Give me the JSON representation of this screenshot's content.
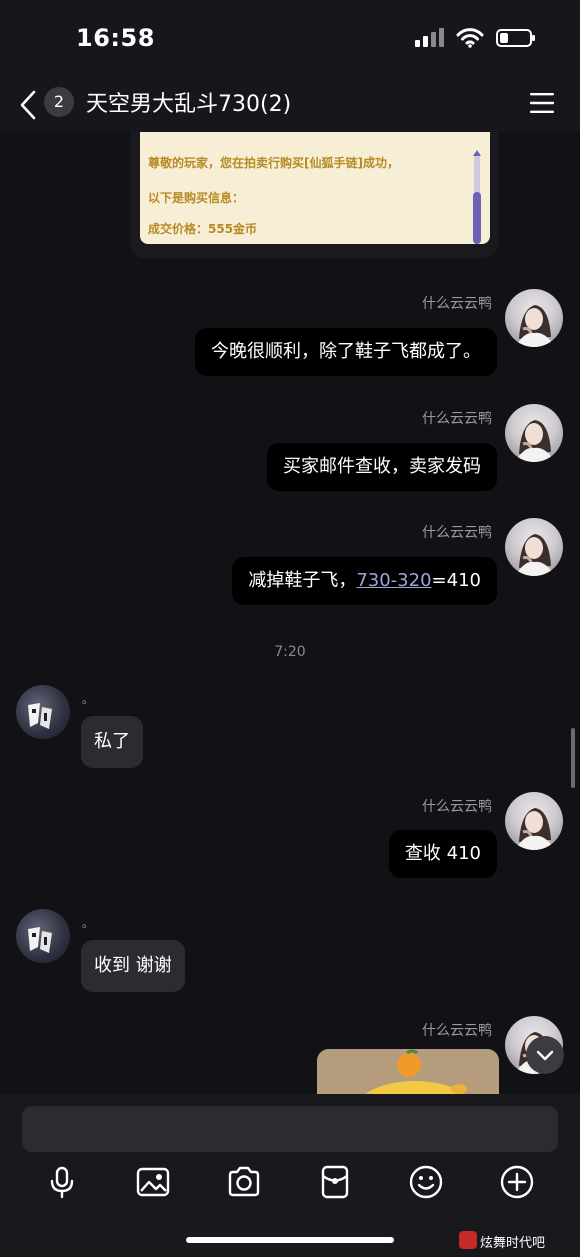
{
  "status_bar": {
    "time": "16:58"
  },
  "header": {
    "unread_count": "2",
    "title": "天空男大乱斗730(2)"
  },
  "game_card": {
    "lines": [
      "尊敬的玩家，您在拍卖行购买[仙狐手链]成功，",
      "以下是购买信息：",
      "成交价格：555金币"
    ]
  },
  "messages": [
    {
      "sender": "什么云云鸭",
      "text": "今晚很顺利，除了鞋子飞都成了。"
    },
    {
      "sender": "什么云云鸭",
      "text": "买家邮件查收，卖家发码"
    },
    {
      "sender": "什么云云鸭",
      "prefix": "减掉鞋子飞，",
      "link": "730-320",
      "suffix": "=410"
    },
    {
      "time": "7:20"
    },
    {
      "sender": "。",
      "text": "私了"
    },
    {
      "sender": "什么云云鸭",
      "text": "查收 410"
    },
    {
      "sender": "。",
      "text": "收到 谢谢"
    },
    {
      "sender": "什么云云鸭"
    }
  ],
  "watermark": "炫舞时代吧"
}
